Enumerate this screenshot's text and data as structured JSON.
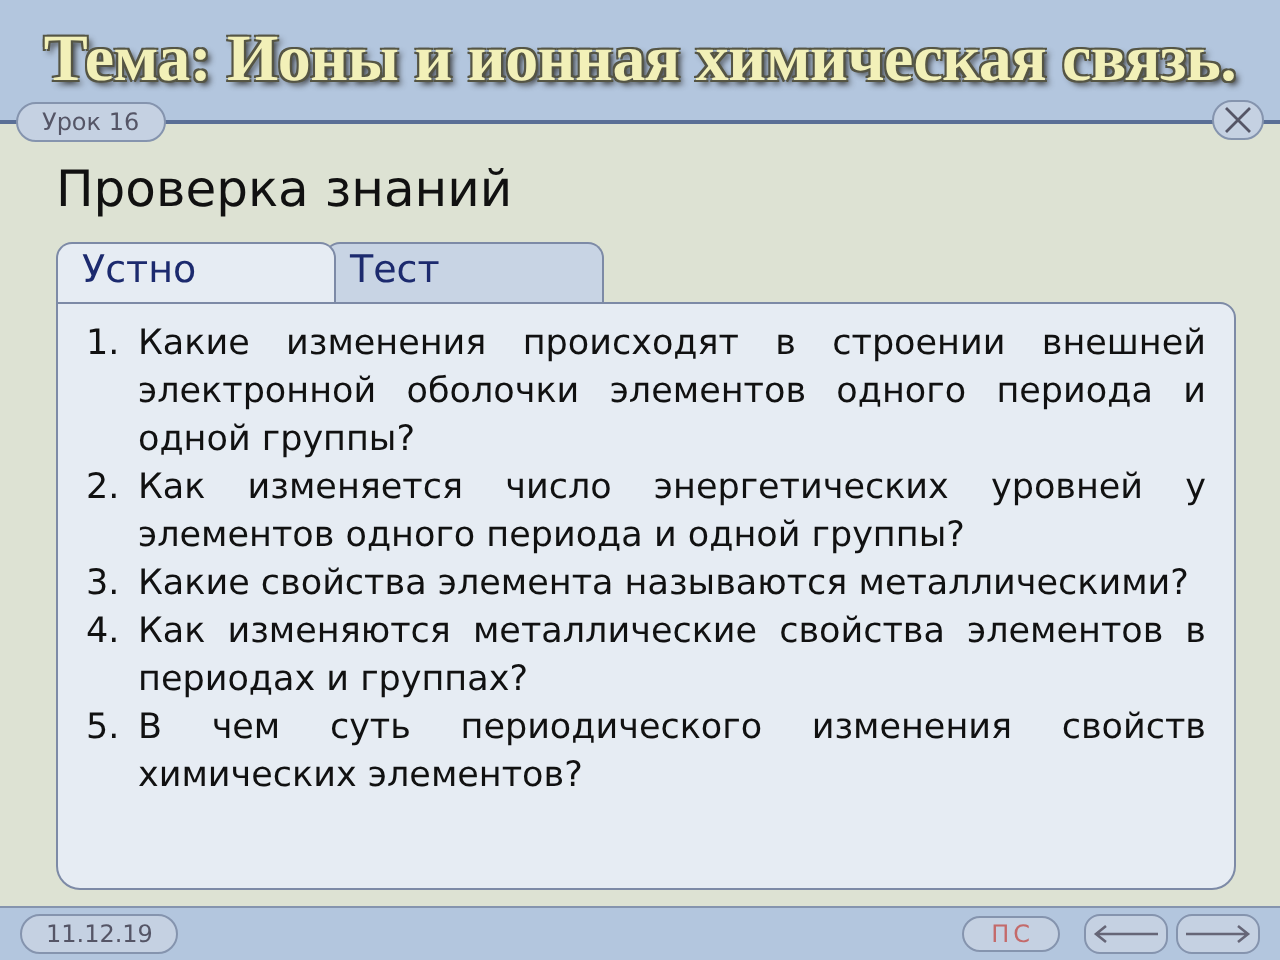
{
  "header": {
    "title": "Тема: Ионы и ионная химическая связь.",
    "lesson": "Урок 16"
  },
  "slide_title": "Проверка знаний",
  "tabs": [
    {
      "label": "Устно",
      "selected": true
    },
    {
      "label": "Тест",
      "selected": false
    }
  ],
  "questions": [
    {
      "number": "1.",
      "text": "Какие изменения происходят в строении внешней электронной оболочки элементов одного периода и одной группы?"
    },
    {
      "number": "2.",
      "text": "Как изменяется число энергетических уровней у элементов одного периода и одной группы?"
    },
    {
      "number": "3.",
      "text": "Какие свойства элемента называются металлическими?"
    },
    {
      "number": "4.",
      "text": "Как изменяются металлические свойства элементов в периодах и группах?"
    },
    {
      "number": "5.",
      "text": "В чем суть периодического изменения свойств химических элементов?"
    }
  ],
  "footer": {
    "date": "11.12.19",
    "badge": [
      "П",
      "С"
    ]
  }
}
